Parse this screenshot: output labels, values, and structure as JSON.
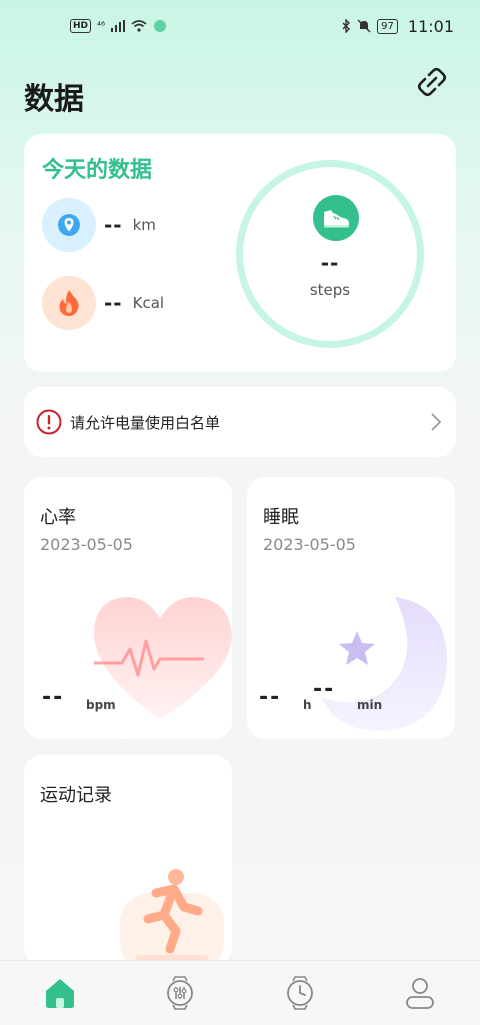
{
  "status_bar": {
    "hd": "HD",
    "signal": "⁴⁶",
    "battery": "97",
    "time": "11:01"
  },
  "header": {
    "title": "数据"
  },
  "today": {
    "title": "今天的数据",
    "distance": {
      "value": "--",
      "unit": "km"
    },
    "calories": {
      "value": "--",
      "unit": "Kcal"
    },
    "steps": {
      "value": "--",
      "unit": "steps"
    }
  },
  "whitelist": {
    "text": "请允许电量使用白名单"
  },
  "heart_rate": {
    "title": "心率",
    "date": "2023-05-05",
    "value": "--",
    "unit": "bpm"
  },
  "sleep": {
    "title": "睡眠",
    "date": "2023-05-05",
    "hours": "--",
    "hours_unit": "h",
    "minutes": "--",
    "minutes_unit": "min"
  },
  "sport": {
    "title": "运动记录"
  },
  "tabs": [
    {
      "icon": "home-icon",
      "active": true
    },
    {
      "icon": "watch-settings-icon",
      "active": false
    },
    {
      "icon": "watch-icon",
      "active": false
    },
    {
      "icon": "profile-icon",
      "active": false
    }
  ],
  "colors": {
    "accent": "#33c08c",
    "ring": "#c6f5e4",
    "alert": "#c8232c"
  }
}
